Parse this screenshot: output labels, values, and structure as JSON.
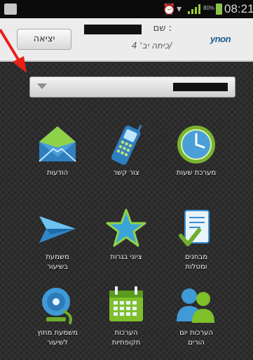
{
  "status_bar": {
    "battery_percent": "80%",
    "time": "08:21",
    "icons": [
      "notification-icon",
      "alarm-icon",
      "wifi-icon",
      "signal-icon",
      "battery-icon"
    ]
  },
  "header": {
    "exit_label": "יציאה",
    "name_label": "שם :",
    "class_label": "כיתה יב' 4/",
    "logo_text": "ynon",
    "name_value_redacted": true
  },
  "selector": {
    "value_redacted": true,
    "icon": "chevron-down-icon"
  },
  "tiles": [
    {
      "label": "הודעות",
      "icon": "envelope-icon",
      "color": "#4a9fd8"
    },
    {
      "label": "צור קשר",
      "icon": "phone-icon",
      "color": "#3f8fd0"
    },
    {
      "label": "מערכת שעות",
      "icon": "clock-icon",
      "color": "#78b42e"
    },
    {
      "label": "משמעת\nבשיעור",
      "icon": "paper-plane-icon",
      "color": "#4aa8e0"
    },
    {
      "label": "ציוני בגרות",
      "icon": "star-icon",
      "color": "#3aa3d8"
    },
    {
      "label": "מבחנים\nומטלות",
      "icon": "document-check-icon",
      "color": "#6fae2c"
    },
    {
      "label": "משמעת מחוץ\nלשיעור",
      "icon": "bell-icon",
      "color": "#3f9ad6"
    },
    {
      "label": "הערכות\nתקופתיות",
      "icon": "calendar-icon",
      "color": "#7fbf2a"
    },
    {
      "label": "הערכות יום\nהורים",
      "icon": "parents-icon",
      "color": "#3f9ad6"
    }
  ],
  "annotation": {
    "color": "#e8201a"
  }
}
